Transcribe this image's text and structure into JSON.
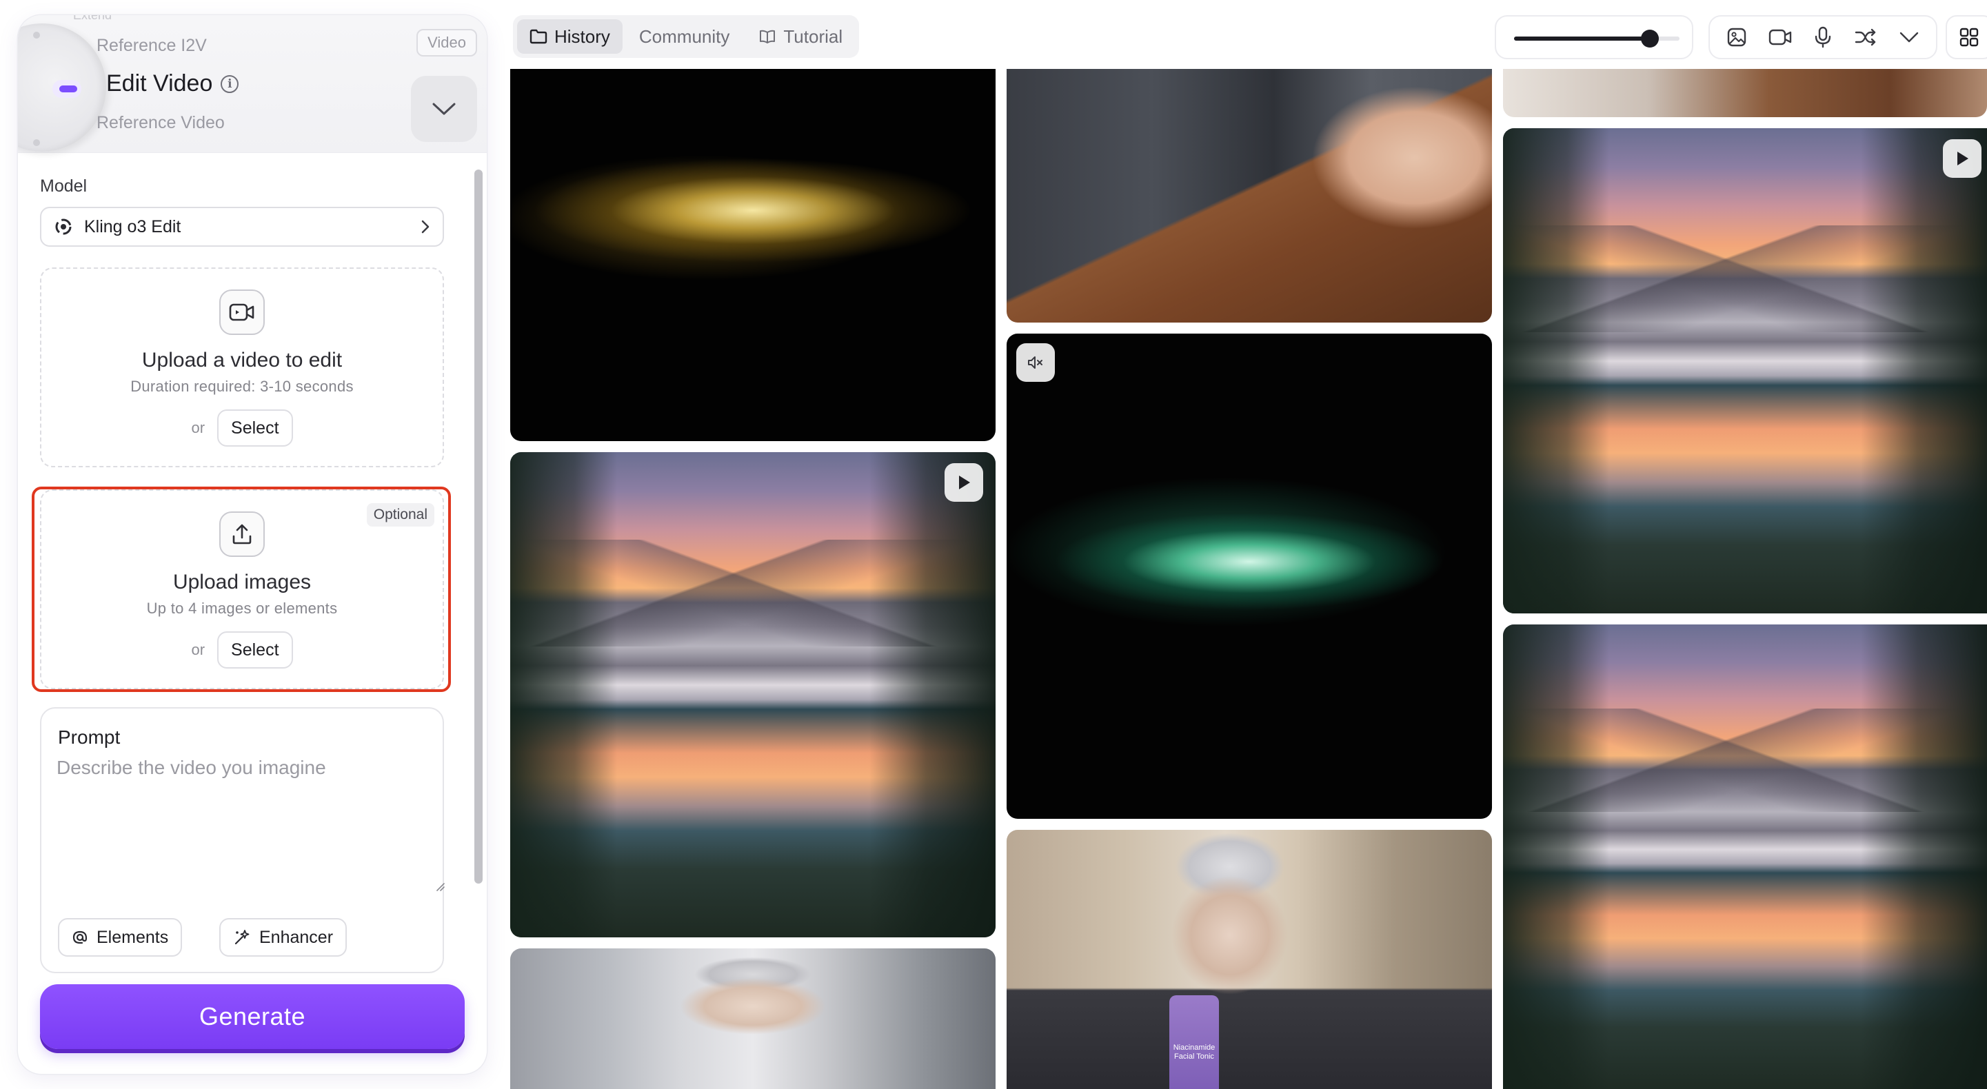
{
  "mode_selector": {
    "faint_above": "Extend",
    "previous": "Reference I2V",
    "current": "Edit Video",
    "next": "Reference Video",
    "badge": "Video",
    "info_icon": "info-icon",
    "chevron_icon": "chevron-down-icon"
  },
  "model": {
    "label": "Model",
    "selected": "Kling o3 Edit",
    "icon": "kling-logo-icon"
  },
  "upload_video": {
    "title": "Upload a video to edit",
    "subtitle": "Duration required: 3-10 seconds",
    "or_text": "or",
    "select_label": "Select",
    "icon": "video-camera-icon"
  },
  "upload_images": {
    "badge": "Optional",
    "title": "Upload images",
    "subtitle": "Up to 4 images or elements",
    "or_text": "or",
    "select_label": "Select",
    "icon": "upload-icon",
    "highlight_color": "#e0381f"
  },
  "prompt": {
    "label": "Prompt",
    "placeholder": "Describe the video you imagine",
    "value": "",
    "chips": [
      {
        "label": "Elements",
        "icon": "at-sign-icon"
      },
      {
        "label": "Enhancer",
        "icon": "sparkle-wand-icon"
      }
    ]
  },
  "generate": {
    "label": "Generate",
    "color": "#7c3ff5"
  },
  "tabs": [
    {
      "label": "History",
      "icon": "folder-icon",
      "active": true
    },
    {
      "label": "Community",
      "active": false
    },
    {
      "label": "Tutorial",
      "icon": "book-icon",
      "active": false
    }
  ],
  "size_slider": {
    "value": 0.82
  },
  "toolbar_icons": [
    "image-icon",
    "video-camera-icon",
    "microphone-icon",
    "shuffle-icon",
    "chevron-down-icon"
  ],
  "grid_icon": "grid-view-icon",
  "gallery": {
    "overlays": {
      "play_icon": "play-icon",
      "mute_icon": "speaker-muted-icon"
    },
    "bottle_text": [
      "Niacinamide",
      "Facial Tonic"
    ]
  }
}
